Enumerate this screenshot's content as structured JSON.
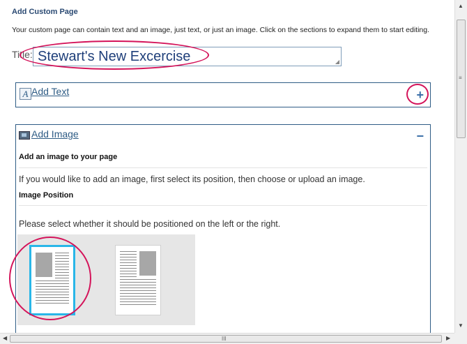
{
  "header": {
    "title": "Add Custom Page",
    "intro": "Your custom page can contain text and an image, just text, or just an image. Click on the sections to expand them to start editing."
  },
  "title_field": {
    "label": "Title:",
    "value": "Stewart's New Excercise"
  },
  "text_section": {
    "label": "Add Text",
    "toggle": "+",
    "icon": "text-A-icon"
  },
  "image_section": {
    "label": "Add Image",
    "toggle": "−",
    "icon": "image-icon",
    "subheading": "Add an image to your page",
    "instruction": "If you would like to add an image, first select its position, then choose or upload an image.",
    "position_heading": "Image Position",
    "position_instruction": "Please select whether it should be positioned on the left or the right.",
    "position_options": [
      {
        "name": "left",
        "selected": true
      },
      {
        "name": "right",
        "selected": false
      }
    ]
  },
  "scrollbars": {
    "vertical_grip": "≡",
    "horizontal_grip": "III"
  },
  "colors": {
    "accent": "#2e5c85",
    "selection": "#29b6e8",
    "annotation": "#d4145a"
  }
}
